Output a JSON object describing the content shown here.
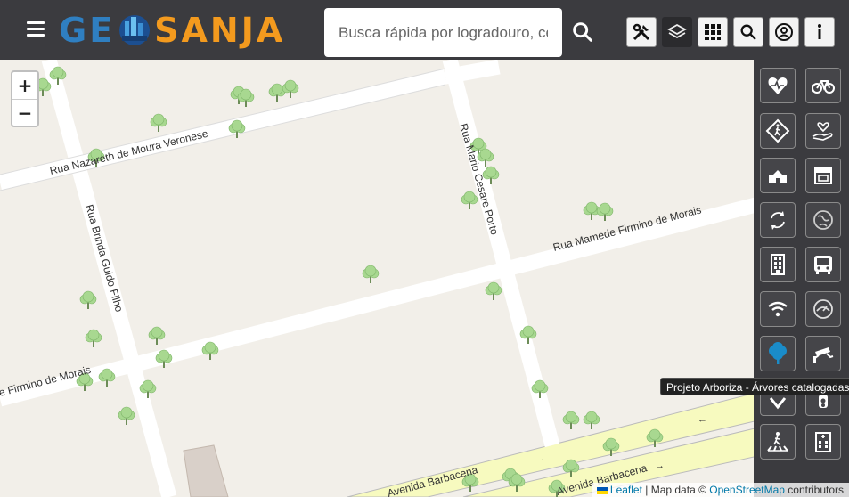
{
  "header": {
    "logo_left": "GE",
    "logo_right": "SANJA",
    "search": {
      "placeholder": "Busca rápida por logradouro, cep..."
    }
  },
  "toolbar": {
    "buttons": [
      {
        "icon": "tools-icon"
      },
      {
        "icon": "layers-icon"
      },
      {
        "icon": "grid-icon"
      },
      {
        "icon": "search-icon"
      },
      {
        "icon": "user-icon"
      },
      {
        "icon": "info-icon"
      }
    ]
  },
  "map": {
    "zoom_in": "+",
    "zoom_out": "−",
    "streets": [
      "Rua Nazareth de Moura Veronese",
      "Rua Mario Cesare Porto",
      "Rua Mamede Firmino de Morais",
      "Rua Brinda Guido Filho",
      "e Firmino de Morais",
      "Avenida Barbacena",
      "Avenida Barbacena"
    ],
    "attribution": {
      "leaflet": "Leaflet",
      "sep": " | Map data © ",
      "osm": "OpenStreetMap",
      "tail": " contributors"
    }
  },
  "side_panel": {
    "buttons": [
      "health-heart-icon",
      "bicycle-icon",
      "pedestrian-sign-icon",
      "hand-heart-icon",
      "building-icon",
      "store-icon",
      "recycle-icon",
      "globe-icon",
      "office-building-icon",
      "bus-icon",
      "wifi-icon",
      "speed-camera-icon",
      "tree-icon",
      "security-camera-icon",
      "layer-pin-icon",
      "traffic-light-icon",
      "crosswalk-icon",
      "hospital-icon"
    ],
    "tooltip": "Projeto Arboriza - Árvores catalogadas"
  },
  "colors": {
    "header_bg": "#3b3b3f",
    "logo_blue": "#2f7fc1",
    "logo_orange": "#f39a1e",
    "tree_active": "#1a8cc9"
  }
}
